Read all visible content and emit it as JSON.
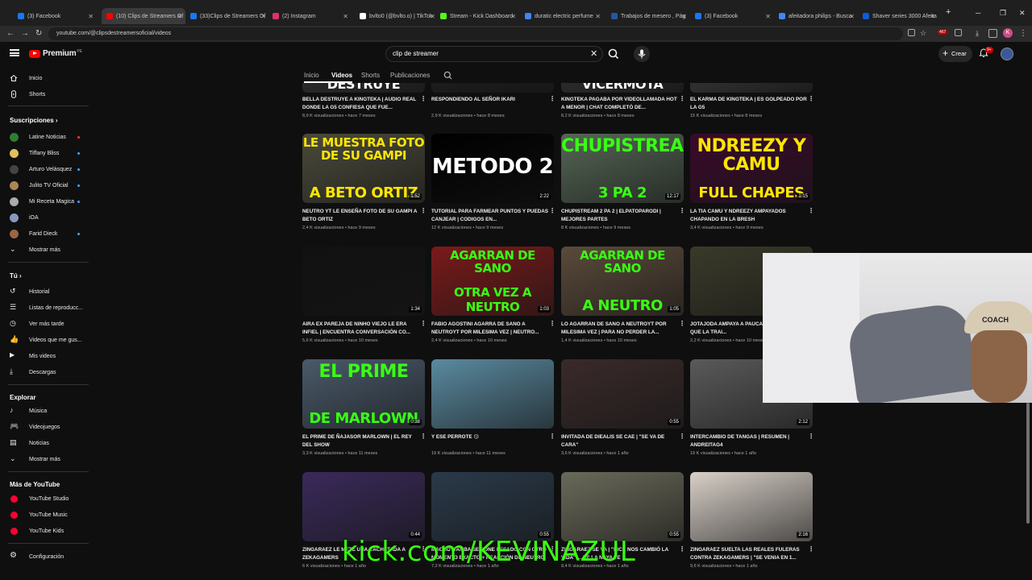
{
  "browser": {
    "tabs": [
      {
        "label": "(3) Facebook",
        "color": "#1877f2"
      },
      {
        "label": "(10) Clips de Streamers Of",
        "color": "#ff0000"
      },
      {
        "label": "(33)Clips de Streamers Of",
        "color": "#1877f2"
      },
      {
        "label": "(2) Instagram",
        "color": "#e1306c"
      },
      {
        "label": "bvlto0 (@bvlto.o) | TikTok",
        "color": "#ffffff"
      },
      {
        "label": "Stream - Kick Dashboard",
        "color": "#53fc18"
      },
      {
        "label": "duratic electric perfume",
        "color": "#4285f4"
      },
      {
        "label": "Trabajos de mesero , Pág",
        "color": "#2557a7"
      },
      {
        "label": "(3) Facebook",
        "color": "#1877f2"
      },
      {
        "label": "afeitadora philips - Busca",
        "color": "#4285f4"
      },
      {
        "label": "Shaver series 3000 Afeita",
        "color": "#0b5ed7"
      }
    ],
    "url": "youtube.com/@clipsdestreamersoficial/videos",
    "ext_badge": "467"
  },
  "youtube": {
    "logo_text": "Premium",
    "logo_country": "PE",
    "search_value": "clip de streamer",
    "create_label": "Crear",
    "notif_count": "9+"
  },
  "sidebar": {
    "main": [
      {
        "label": "Inicio",
        "icon": "home-icon"
      },
      {
        "label": "Shorts",
        "icon": "shorts-icon"
      }
    ],
    "subs_heading": "Suscripciones",
    "subs": [
      {
        "label": "Latine Noticias",
        "color": "#2e7d32",
        "live": true
      },
      {
        "label": "Tiffany Bliss",
        "color": "#e0c060",
        "live": true
      },
      {
        "label": "Arturo Velásquez",
        "color": "#444444",
        "live": true
      },
      {
        "label": "Julito TV Oficial",
        "color": "#aa8855",
        "live": true
      },
      {
        "label": "Mi Receta Magica",
        "color": "#aaaaaa",
        "live": true
      },
      {
        "label": "iOA",
        "color": "#8899bb",
        "live": false
      },
      {
        "label": "Farid Dieck",
        "color": "#996644",
        "live": true
      }
    ],
    "show_more": "Mostrar más",
    "you_heading": "Tú",
    "you": [
      {
        "label": "Historial",
        "icon": "history-icon"
      },
      {
        "label": "Listas de reproducc...",
        "icon": "playlist-icon"
      },
      {
        "label": "Ver más tarde",
        "icon": "watch-later-icon"
      },
      {
        "label": "Videos que me gus...",
        "icon": "like-icon"
      },
      {
        "label": "Mis videos",
        "icon": "my-videos-icon"
      },
      {
        "label": "Descargas",
        "icon": "download-icon"
      }
    ],
    "explore_heading": "Explorar",
    "explore": [
      {
        "label": "Música",
        "icon": "music-icon"
      },
      {
        "label": "Videojuegos",
        "icon": "gaming-icon"
      },
      {
        "label": "Noticias",
        "icon": "news-icon"
      },
      {
        "label": "Mostrar más",
        "icon": "chevron-down-icon"
      }
    ],
    "more_heading": "Más de YouTube",
    "more": [
      {
        "label": "YouTube Studio"
      },
      {
        "label": "YouTube Music"
      },
      {
        "label": "YouTube Kids"
      }
    ],
    "settings": "Configuración"
  },
  "channel_tabs": [
    "Inicio",
    "Videos",
    "Shorts",
    "Publicaciones"
  ],
  "videos": [
    {
      "title": "BELLA DESTRUYE A KINGTEKA | AUDIO REAL DONDE LA G5 CONFIESA QUE FUE...",
      "views": "8,9 K visualizaciones",
      "age": "hace 7 meses",
      "duration": "",
      "thumb_text": "DESTRUYE",
      "bg": "#2a2a2a",
      "txt": "#ffffff"
    },
    {
      "title": "RESPONDIENDO AL SEÑOR IKARI",
      "views": "2,9 K visualizaciones",
      "age": "hace 8 meses",
      "duration": "",
      "thumb_text": "",
      "bg": "#1c1c1c",
      "txt": "#ffffff"
    },
    {
      "title": "KINGTEKA PAGABA POR VIDEOLLAMADA HOT A MENOR | CHAT COMPLETÓ DE...",
      "views": "8,2 K visualizaciones",
      "age": "hace 8 meses",
      "duration": "",
      "thumb_text": "VICERMOTA",
      "bg": "#2a2a2a",
      "txt": "#ffffff"
    },
    {
      "title": "EL KARMA DE KINGTEKA | ES GOLPEADO POR LA G5",
      "views": "15 K visualizaciones",
      "age": "hace 8 meses",
      "duration": "",
      "thumb_text": "",
      "bg": "#303030",
      "txt": "#ffffff"
    },
    {
      "title": "NEUTRO YT LE ENSEÑA FOTO DE SU GAMPI A BETO ORTIZ",
      "views": "2,4 K visualizaciones",
      "age": "hace 9 meses",
      "duration": "1:52",
      "thumb_text": "LE MUESTRA FOTO DE SU GAMPI",
      "thumb_text2": "A BETO ORTIZ",
      "bg": "#4a4a3a",
      "txt": "#ffe600"
    },
    {
      "title": "TUTORIAL PARA FARMEAR PUNTOS Y PUEDAS CANJEAR | CODIGOS EN...",
      "views": "12 K visualizaciones",
      "age": "hace 9 meses",
      "duration": "2:22",
      "thumb_text": "METODO 2",
      "bg": "#000000",
      "txt": "#ffffff"
    },
    {
      "title": "CHUPISTREAM 2 PA 2 | ELPATOPARODI | MEJORES PARTES",
      "views": "8 K visualizaciones",
      "age": "hace 9 meses",
      "duration": "12:17",
      "thumb_text": "CHUPISTREAM",
      "thumb_text2": "3 PA 2",
      "bg": "#556655",
      "txt": "#39ff14"
    },
    {
      "title": "LA TIA CAMU Y NDREEZY AMPAYADOS CHAPANDO EN LA BRESH",
      "views": "3,4 K visualizaciones",
      "age": "hace 9 meses",
      "duration": "1:15",
      "thumb_text": "NDREEZY Y CAMU",
      "thumb_text2": "FULL CHAPES",
      "bg": "#3a0a2a",
      "txt": "#ffe600"
    },
    {
      "title": "AIRA EX PAREJA DE NINHO VIEJO LE ERA INFIEL | ENCUENTRA CONVERSACIÓN CO...",
      "views": "5,6 K visualizaciones",
      "age": "hace 10 meses",
      "duration": "1:34",
      "thumb_text": "",
      "bg": "#111111",
      "txt": "#ffffff"
    },
    {
      "title": "FABIO AGOSTINI AGARRA DE SANO A NEUTROYT POR MILESIMA VEZ | NEUTRO...",
      "views": "2,4 K visualizaciones",
      "age": "hace 10 meses",
      "duration": "1:03",
      "thumb_text": "AGARRAN DE SANO",
      "thumb_text2": "OTRA VEZ A NEUTRO",
      "bg": "#7a1a1a",
      "txt": "#39ff14"
    },
    {
      "title": "LO AGARRAN DE SANO A NEUTROYT POR MILESIMA VEZ | PARA NO PERDER LA...",
      "views": "1,4 K visualizaciones",
      "age": "hace 10 meses",
      "duration": "1:05",
      "thumb_text": "AGARRAN DE SANO",
      "thumb_text2": "A NEUTRO",
      "bg": "#5a4a3a",
      "txt": "#39ff14"
    },
    {
      "title": "JOTAJODA AMPAYA A PAUCAR TOP DONADOR QUE LA TRAI...",
      "views": "2,2 K visualizaciones",
      "age": "hace 10 meses",
      "duration": "",
      "thumb_text": "",
      "bg": "#3a3a2a",
      "txt": "#ffffff"
    },
    {
      "title": "EL PRIME DE ÑAJASOR MARLOWN | EL REY DEL SHOW",
      "views": "3,3 K visualizaciones",
      "age": "hace 11 meses",
      "duration": "0:38",
      "thumb_text": "EL PRIME",
      "thumb_text2": "DE MARLOWN",
      "bg": "#4a5a6a",
      "txt": "#39ff14"
    },
    {
      "title": "Y ESE PERROTE 😏",
      "views": "19 K visualizaciones",
      "age": "hace 11 meses",
      "duration": "",
      "thumb_text": "",
      "bg": "#5a8aa0",
      "txt": "#ffffff"
    },
    {
      "title": "INVITADA DE DIEALIS SE CAE | \"SE VA DE CARA\"",
      "views": "3,6 K visualizaciones",
      "age": "hace 1 año",
      "duration": "0:55",
      "thumb_text": "",
      "bg": "#3a2a2a",
      "txt": "#ffffff"
    },
    {
      "title": "INTERCAMBIO DE TANGAS | RESUMEN | ANDREITAG4",
      "views": "19 K visualizaciones",
      "age": "hace 1 año",
      "duration": "2:12",
      "thumb_text": "",
      "bg": "#5a5a5a",
      "txt": "#ffffff"
    },
    {
      "title": "ZINGARAEZ LE METE UNA CACHETADA A ZEKAGAMERS",
      "views": "6 K visualizaciones",
      "age": "hace 1 año",
      "duration": "0:44",
      "thumb_text": "",
      "bg": "#3a2a5a",
      "txt": "#ffffff"
    },
    {
      "title": "MACHO GAMBA SE PONE PESADO CON OTRO MOMENTO EXACTO + REACCIÓN DE NEUTRO",
      "views": "7,2 K visualizaciones",
      "age": "hace 1 año",
      "duration": "0:55",
      "thumb_text": "",
      "bg": "#2a3a4a",
      "txt": "#ffffff"
    },
    {
      "title": "ZINGARAEZ SE VA | \"KICK NOS CAMBIÓ LA VIDA\" ... DE LA NAYA TE",
      "views": "8,4 K visualizaciones",
      "age": "hace 1 año",
      "duration": "0:55",
      "thumb_text": "",
      "bg": "#6a6a5a",
      "txt": "#ffffff"
    },
    {
      "title": "ZINGARAEZ SUELTA LAS REALES FULERAS CONTRA ZEKAGAMERS | \"SE VENIA EN 1...",
      "views": "9,6 K visualizaciones",
      "age": "hace 1 año",
      "duration": "2:16",
      "thumb_text": "",
      "bg": "#d8d0c8",
      "txt": "#ffffff"
    }
  ],
  "overlay_text": "kick.com/KEVINAZUL",
  "webcam_cap_text": "COACH"
}
